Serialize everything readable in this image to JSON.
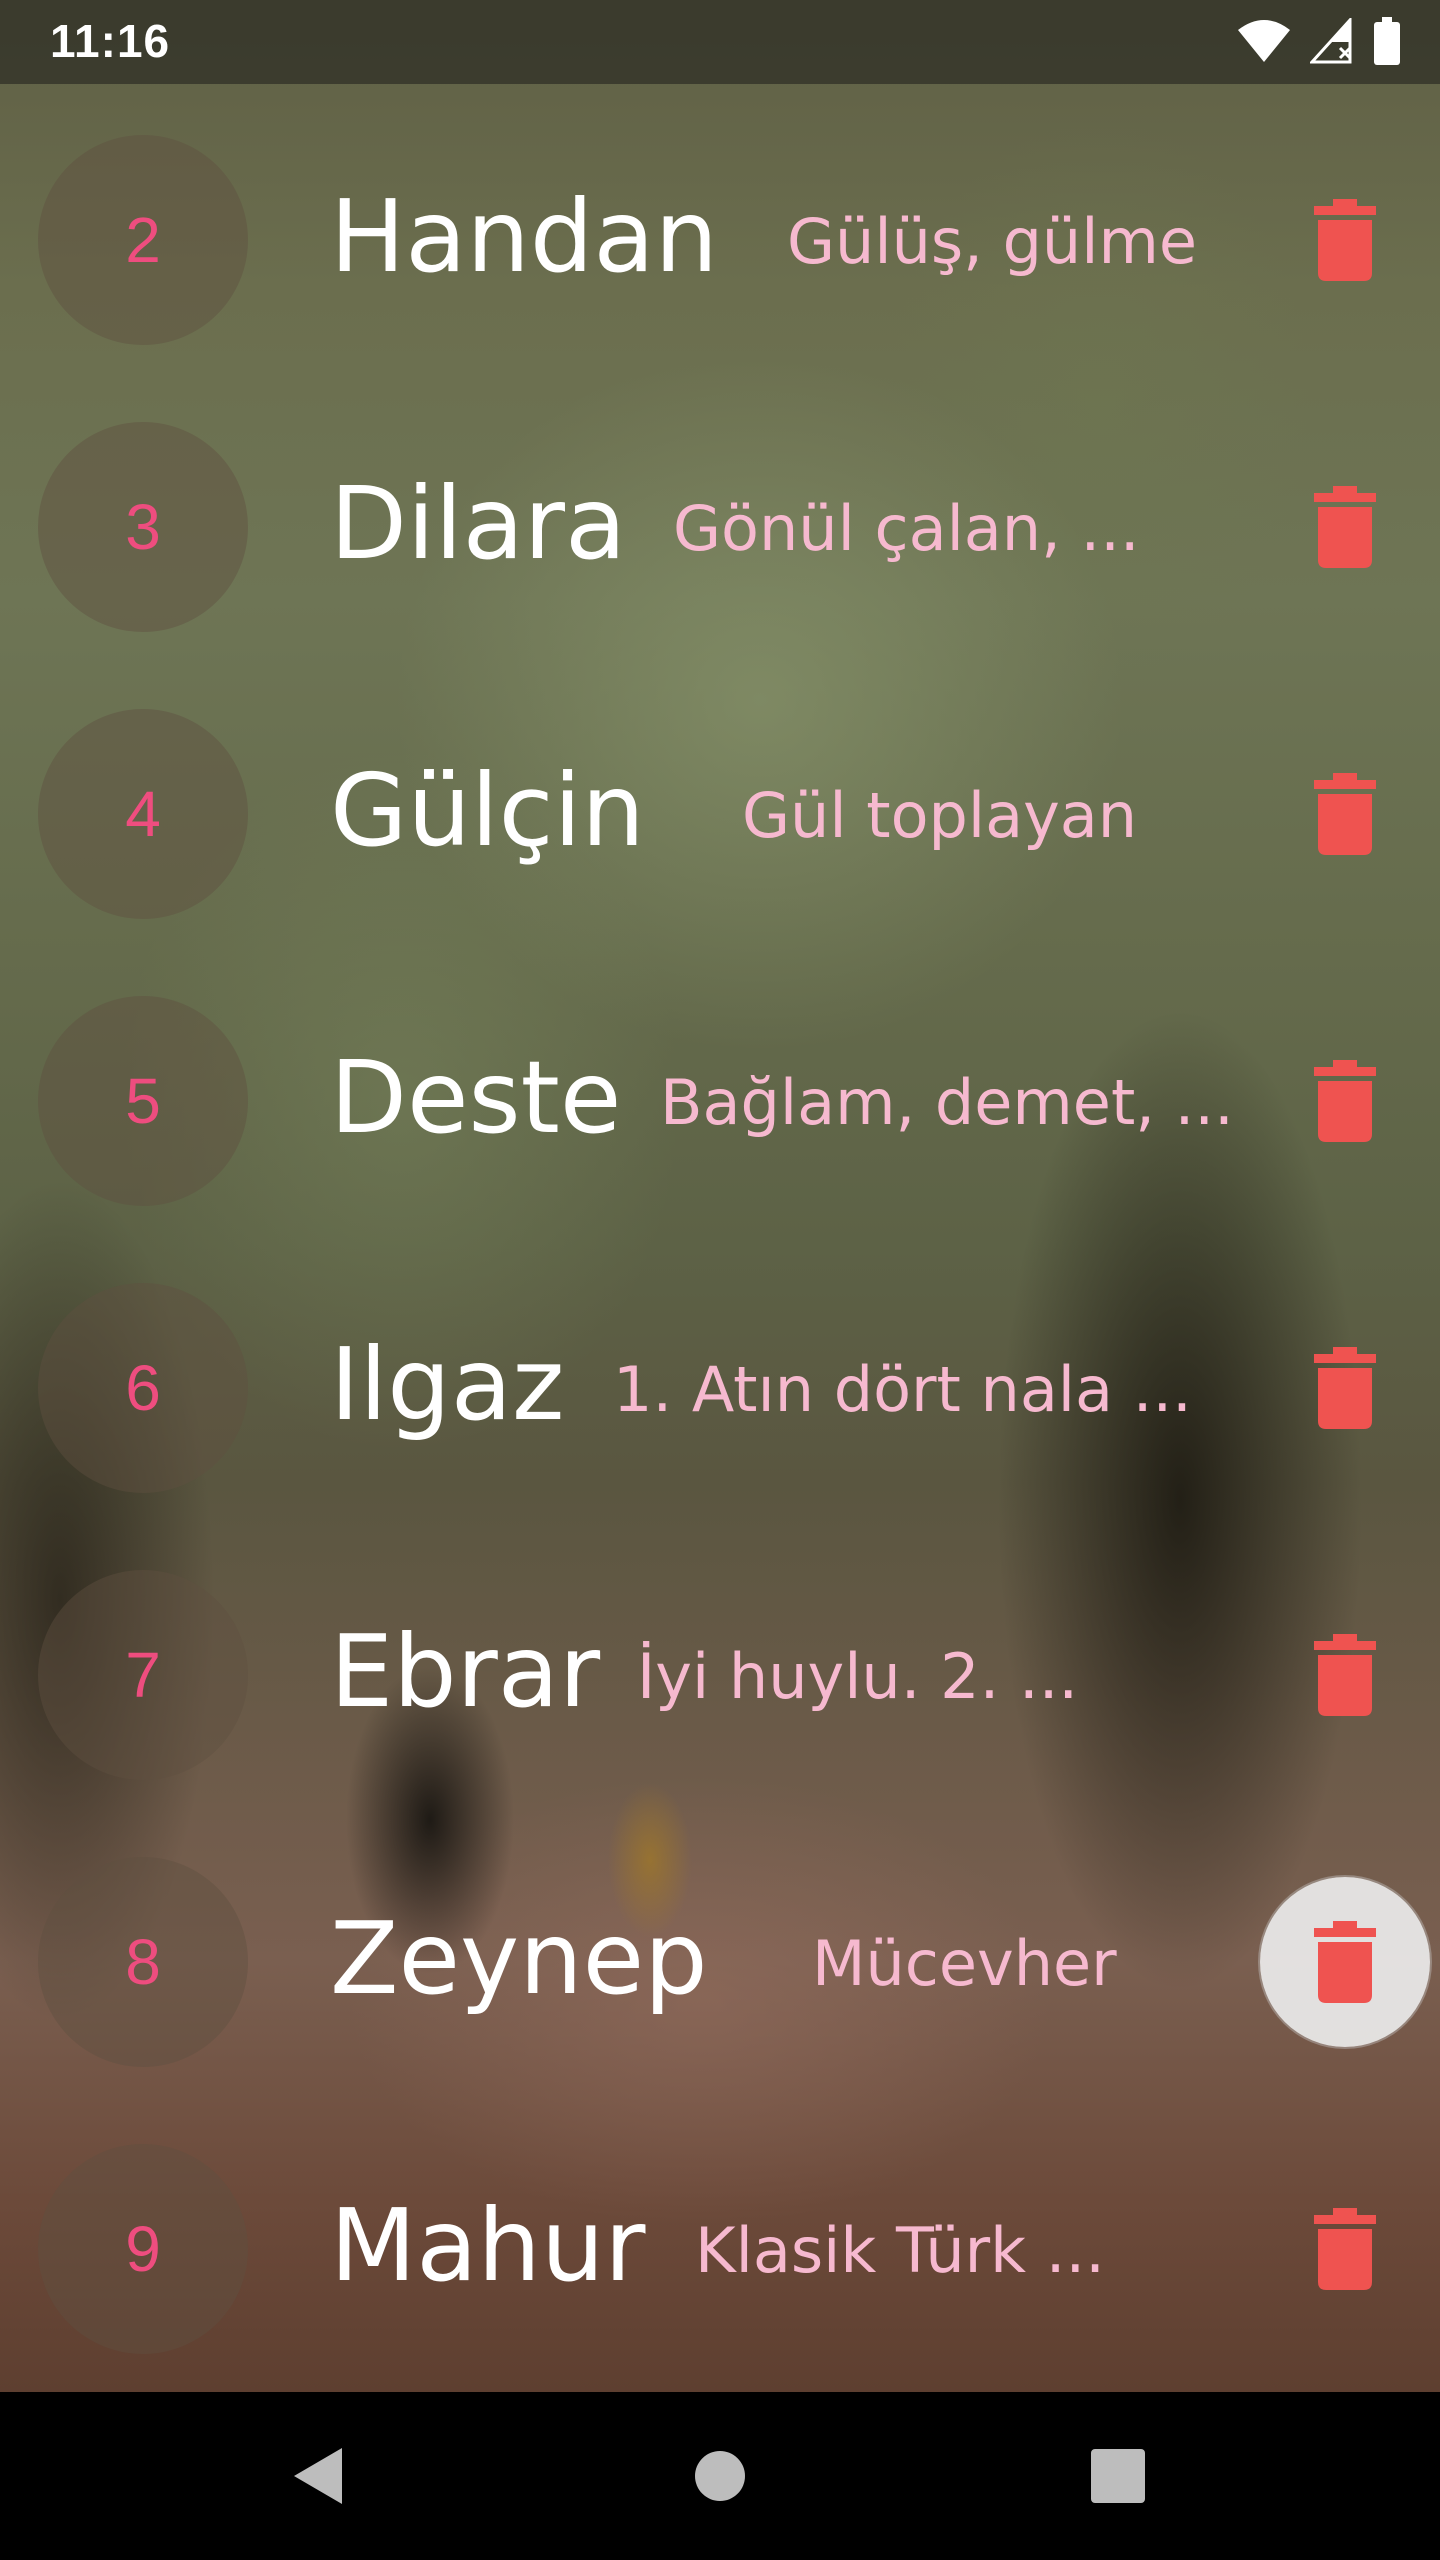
{
  "status_bar": {
    "time": "11:16",
    "icons": [
      "wifi-icon",
      "cellular-no-signal-icon",
      "battery-icon"
    ]
  },
  "theme": {
    "number_color": "#ee4d7f",
    "name_color": "#ffffff",
    "meaning_color": "#f6b9cf",
    "delete_color": "#ef5350"
  },
  "list": {
    "items": [
      {
        "number": "2",
        "name": "Handan",
        "meaning": "Gülüş, gülme"
      },
      {
        "number": "3",
        "name": "Dilara",
        "meaning": "Gönül çalan, ..."
      },
      {
        "number": "4",
        "name": "Gülçin",
        "meaning": "Gül toplayan"
      },
      {
        "number": "5",
        "name": "Deste",
        "meaning": "Bağlam, demet, ..."
      },
      {
        "number": "6",
        "name": "Ilgaz",
        "meaning": "1. Atın dört nala ..."
      },
      {
        "number": "7",
        "name": "Ebrar",
        "meaning": "İyi huylu. 2. ..."
      },
      {
        "number": "8",
        "name": "Zeynep",
        "meaning": "Mücevher"
      },
      {
        "number": "9",
        "name": "Mahur",
        "meaning": "Klasik Türk ..."
      }
    ],
    "delete_icon": "trash-icon"
  },
  "nav_bar": {
    "buttons": [
      "back-icon",
      "home-icon",
      "recents-icon"
    ]
  }
}
